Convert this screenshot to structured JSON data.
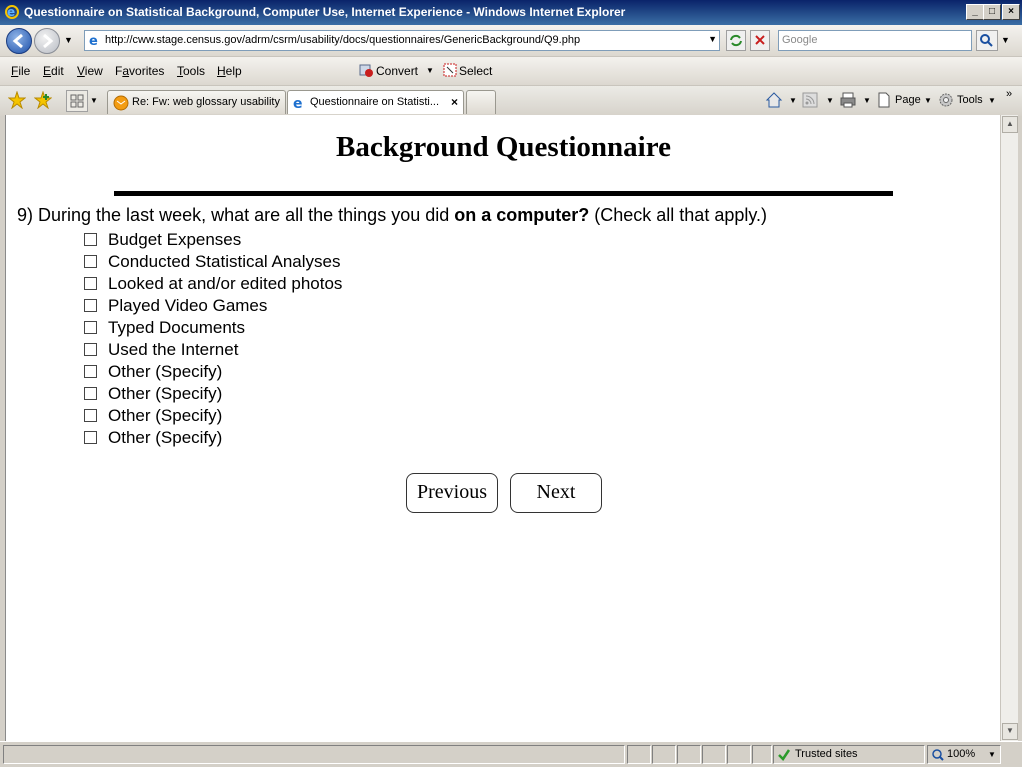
{
  "window": {
    "title": "Questionnaire on Statistical Background, Computer Use, Internet Experience - Windows Internet Explorer"
  },
  "address": {
    "url": "http://cww.stage.census.gov/adrm/csrm/usability/docs/questionnaires/GenericBackground/Q9.php"
  },
  "search": {
    "placeholder": "Google"
  },
  "menu": {
    "items": [
      {
        "pre": "",
        "ul": "F",
        "post": "ile"
      },
      {
        "pre": "",
        "ul": "E",
        "post": "dit"
      },
      {
        "pre": "",
        "ul": "V",
        "post": "iew"
      },
      {
        "pre": "F",
        "ul": "a",
        "post": "vorites"
      },
      {
        "pre": "",
        "ul": "T",
        "post": "ools"
      },
      {
        "pre": "",
        "ul": "H",
        "post": "elp"
      }
    ],
    "convert": "Convert",
    "select": "Select"
  },
  "tabs": [
    {
      "label": "Re: Fw: web glossary usability"
    },
    {
      "label": "Questionnaire on Statisti..."
    }
  ],
  "toolbar": {
    "page": "Page",
    "tools": "Tools"
  },
  "page": {
    "heading": "Background Questionnaire",
    "question": {
      "prefix": "9) During the last week, what are all the things you did ",
      "bold": "on a computer?",
      "suffix": " (Check all that apply.)"
    },
    "options": [
      "Budget Expenses",
      "Conducted Statistical Analyses",
      "Looked at and/or edited photos",
      "Played Video Games",
      "Typed Documents",
      "Used the Internet",
      "Other (Specify)",
      "Other (Specify)",
      "Other (Specify)",
      "Other (Specify)"
    ],
    "previous_label": "Previous",
    "next_label": "Next"
  },
  "status": {
    "zone": "Trusted sites",
    "zoom": "100%"
  }
}
